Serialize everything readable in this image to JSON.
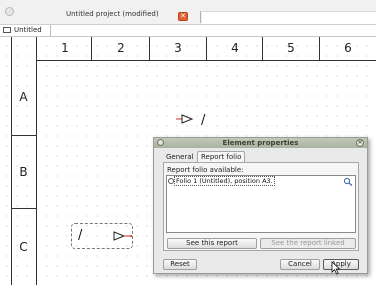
{
  "window": {
    "title": "Untitled project (modified)",
    "close_glyph": "✕"
  },
  "project_tab": {
    "label": "Untitled"
  },
  "sheet": {
    "columns": [
      "1",
      "2",
      "3",
      "4",
      "5",
      "6"
    ],
    "rows": [
      "A",
      "B",
      "C"
    ],
    "symbol_slash": "/"
  },
  "dialog": {
    "title": "Element properties",
    "close_glyph": "✕",
    "tabs": [
      {
        "label": "General",
        "selected": false
      },
      {
        "label": "Report folio",
        "selected": true
      }
    ],
    "list_label": "Report folio available:",
    "list_items": [
      {
        "text": "Folio  1 (Untitled), position A3.",
        "selected": true
      }
    ],
    "buttons": {
      "see_report": "See this report",
      "see_linked": "See the report linked",
      "reset": "Reset",
      "cancel": "Cancel",
      "apply": "Apply"
    }
  },
  "colors": {
    "dialog_title_gradient": "#aab19e",
    "close_tab": "#e2612f",
    "terminal_red": "#cc2b2b"
  },
  "icons": [
    "app-icon",
    "close-icon",
    "sheet-icon",
    "search-icon",
    "arrow-terminal-icon",
    "mouse-cursor-icon"
  ]
}
